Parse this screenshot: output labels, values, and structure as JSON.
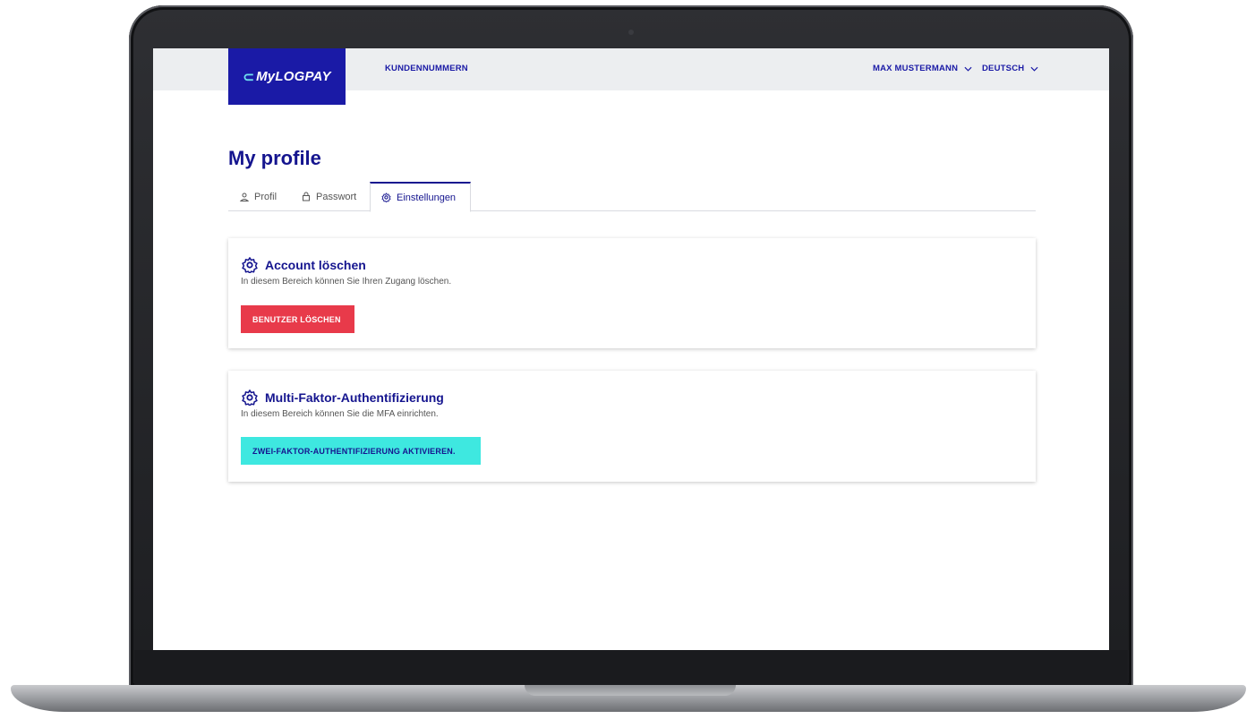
{
  "header": {
    "logo_text": "MyLOGPAY",
    "nav_link": "KUNDENNUMMERN",
    "user_name": "MAX MUSTERMANN",
    "language": "DEUTSCH"
  },
  "page": {
    "title": "My profile"
  },
  "tabs": [
    {
      "label": "Profil",
      "icon": "user-icon"
    },
    {
      "label": "Passwort",
      "icon": "lock-icon"
    },
    {
      "label": "Einstellungen",
      "icon": "gear-icon",
      "active": true
    }
  ],
  "cards": [
    {
      "title": "Account löschen",
      "description": "In diesem Bereich können Sie Ihren Zugang löschen.",
      "button_label": "BENUTZER LÖSCHEN",
      "icon": "gear-icon"
    },
    {
      "title": "Multi-Faktor-Authentifizierung",
      "description": "In diesem Bereich können Sie die MFA einrichten.",
      "button_label": "ZWEI-FAKTOR-AUTHENTIFIZIERUNG AKTIVIEREN.",
      "icon": "gear-icon"
    }
  ],
  "colors": {
    "brand_blue": "#1a1aa6",
    "danger_red": "#e83a4a",
    "accent_cyan": "#3ee8e0"
  }
}
